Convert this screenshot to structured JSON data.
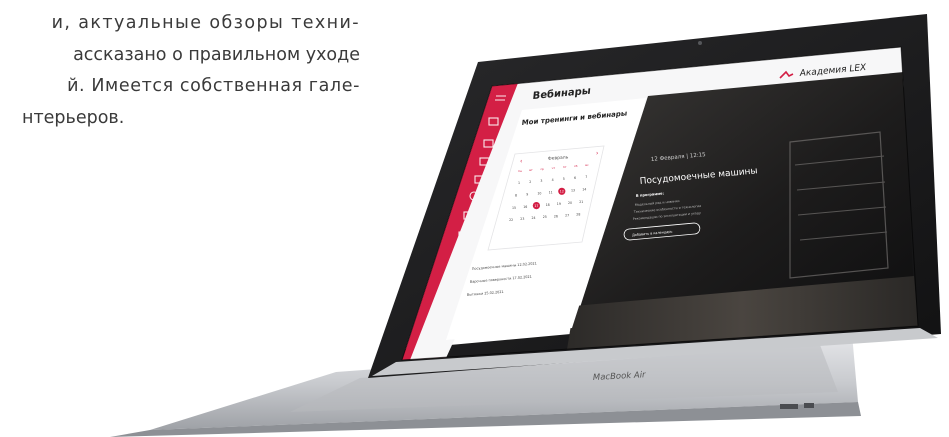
{
  "article": {
    "lines": [
      "и, актуальные обзоры техни-",
      "ассказано о правильном уходе",
      "й. Имеется собственная гале-",
      "нтерьеров."
    ]
  },
  "laptop": {
    "model_label": "MacBook Air"
  },
  "screen": {
    "brand": "Академия LEX",
    "page_title": "Вебинары",
    "section_title": "Мои тренинги и вебинары",
    "calendar": {
      "month": "Февраль",
      "weekdays": [
        "пн",
        "вт",
        "ср",
        "чт",
        "пт",
        "сб",
        "вс"
      ],
      "days": [
        "1",
        "2",
        "3",
        "4",
        "5",
        "6",
        "7",
        "8",
        "9",
        "10",
        "11",
        "12",
        "13",
        "14",
        "15",
        "16",
        "17",
        "18",
        "19",
        "20",
        "21",
        "22",
        "23",
        "24",
        "25",
        "26",
        "27",
        "28"
      ],
      "prev_icon": "chevron-left-icon",
      "next_icon": "chevron-right-icon"
    },
    "events": [
      "Посудомоечные машины 12.02.2021",
      "Варочные поверхности 17.02.2021",
      "Вытяжки 25.02.2021"
    ],
    "webinar": {
      "date": "12 Февраля | 12:15",
      "title": "Посудомоечные машины",
      "program_label": "В программе:",
      "program_items": [
        "Модельный ряд и новинки",
        "Технические особенности и технологии",
        "Рекомендации по эксплуатации и уходу"
      ],
      "button": "Добавить в календарь"
    },
    "colors": {
      "accent": "#d31f45",
      "dark_panel": "#1c1c1e"
    }
  }
}
